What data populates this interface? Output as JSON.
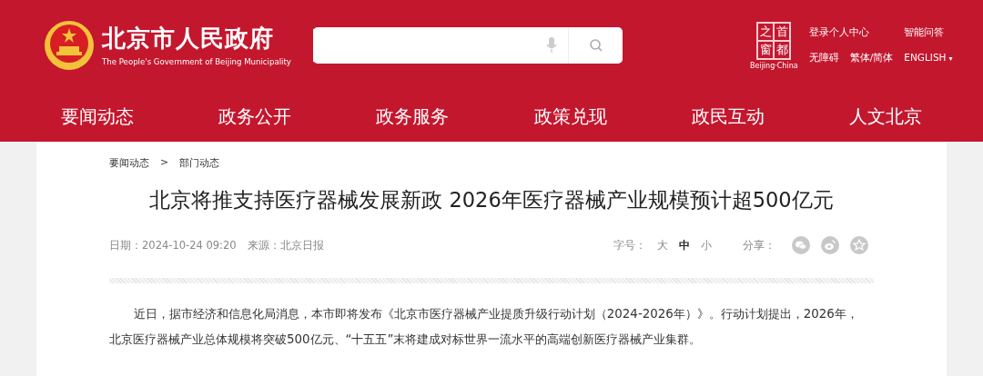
{
  "header": {
    "site_name": "北京市人民政府",
    "site_name_en": "The People's Government of Beijing Municipality",
    "capital_logo": {
      "chars": [
        "之",
        "首",
        "窗",
        "都"
      ],
      "caption": "Beijing·China"
    },
    "links": [
      "登录个人中心",
      "智能问答",
      "无障碍",
      "繁体/简体",
      "ENGLISH"
    ],
    "language_caret": "▾"
  },
  "nav": [
    {
      "label": "要闻动态",
      "selected": false
    },
    {
      "label": "政务公开",
      "selected": false
    },
    {
      "label": "政务服务",
      "selected": false
    },
    {
      "label": "政策兑现",
      "selected": false
    },
    {
      "label": "政民互动",
      "selected": false
    },
    {
      "label": "人文北京",
      "selected": false
    }
  ],
  "breadcrumb": {
    "items": [
      "要闻动态",
      "部门动态"
    ],
    "separator": ">"
  },
  "article": {
    "title": "北京将推支持医疗器械发展新政 2026年医疗器械产业规模预计超500亿元",
    "date": "日期：2024-10-24 09:20",
    "source": "来源：北京日报",
    "font_size_label": "字号：",
    "font_sizes": [
      {
        "label": "大",
        "selected": false
      },
      {
        "label": "中",
        "selected": true
      },
      {
        "label": "小",
        "selected": false
      }
    ],
    "share_label": "分享：",
    "body": "近日，据市经济和信息化局消息，本市即将发布《北京市医疗器械产业提质升级行动计划（2024-2026年）》。行动计划提出，2026年，北京医疗器械产业总体规模将突破500亿元、“十五五”末将建成对标世界一流水平的高端创新医疗器械产业集群。"
  }
}
